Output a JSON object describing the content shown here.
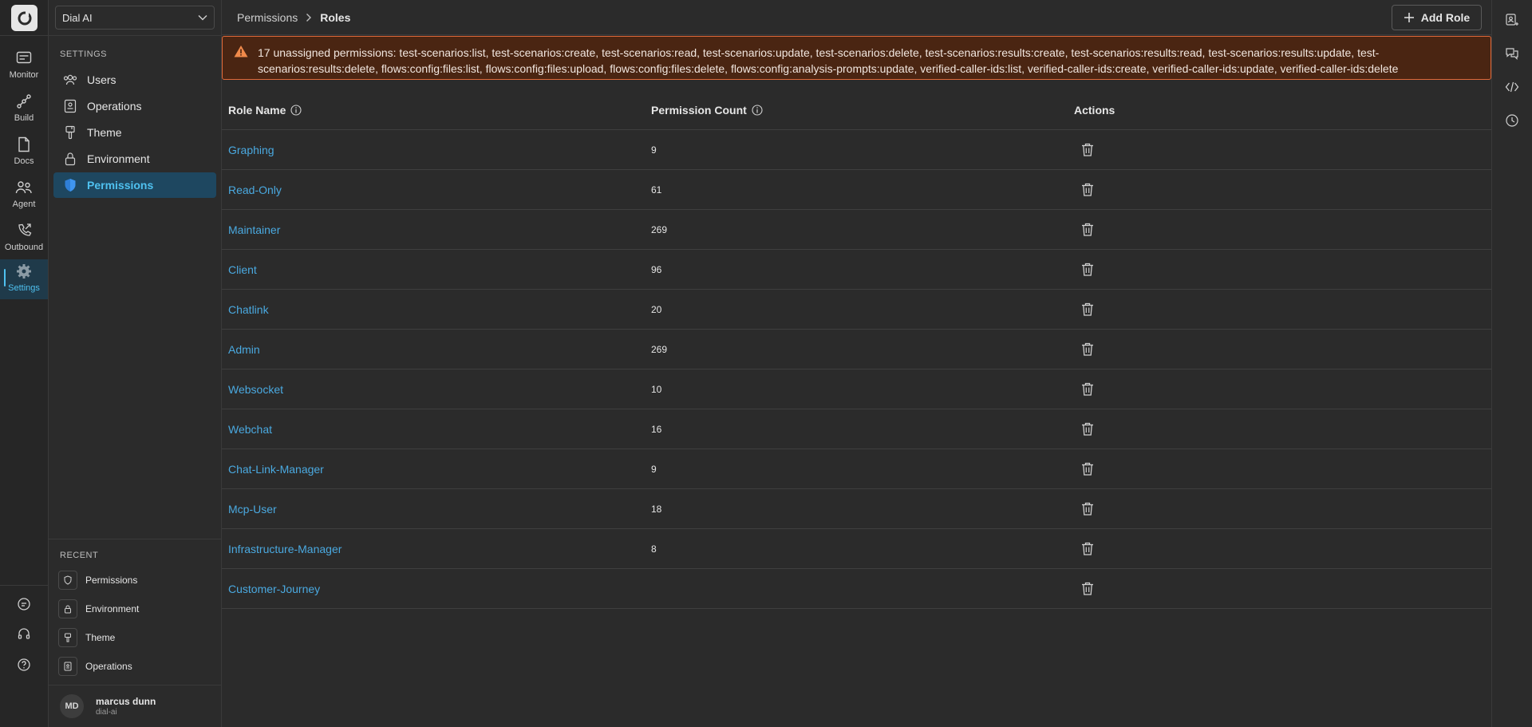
{
  "rail": {
    "items": [
      {
        "label": "Monitor",
        "icon": "monitor-icon"
      },
      {
        "label": "Build",
        "icon": "build-icon"
      },
      {
        "label": "Docs",
        "icon": "docs-icon"
      },
      {
        "label": "Agent",
        "icon": "agent-icon"
      },
      {
        "label": "Outbound",
        "icon": "outbound-icon"
      },
      {
        "label": "Settings",
        "icon": "gear-icon",
        "active": true
      }
    ],
    "bottom_icons": [
      "chat-icon",
      "headset-icon",
      "help-icon"
    ]
  },
  "sidebar": {
    "workspace": "Dial AI",
    "settings_title": "SETTINGS",
    "items": [
      {
        "label": "Users",
        "icon": "users-icon"
      },
      {
        "label": "Operations",
        "icon": "operations-icon"
      },
      {
        "label": "Theme",
        "icon": "paint-brush-icon"
      },
      {
        "label": "Environment",
        "icon": "lock-icon"
      },
      {
        "label": "Permissions",
        "icon": "shield-icon",
        "active": true
      }
    ],
    "recent_title": "RECENT",
    "recent": [
      {
        "label": "Permissions",
        "icon": "shield-icon"
      },
      {
        "label": "Environment",
        "icon": "lock-icon"
      },
      {
        "label": "Theme",
        "icon": "paint-brush-icon"
      },
      {
        "label": "Operations",
        "icon": "operations-icon"
      }
    ],
    "user": {
      "initials": "MD",
      "name": "marcus dunn",
      "org": "dial-ai"
    }
  },
  "header": {
    "breadcrumb_parent": "Permissions",
    "breadcrumb_current": "Roles",
    "add_role_label": "Add Role"
  },
  "alert": {
    "text": "17 unassigned permissions: test-scenarios:list, test-scenarios:create, test-scenarios:read, test-scenarios:update, test-scenarios:delete, test-scenarios:results:create, test-scenarios:results:read, test-scenarios:results:update, test-scenarios:results:delete, flows:config:files:list, flows:config:files:upload, flows:config:files:delete, flows:config:analysis-prompts:update, verified-caller-ids:list, verified-caller-ids:create, verified-caller-ids:update, verified-caller-ids:delete"
  },
  "table": {
    "columns": [
      "Role Name",
      "Permission Count",
      "Actions"
    ],
    "rows": [
      {
        "name": "Graphing",
        "count": "9"
      },
      {
        "name": "Read-Only",
        "count": "61"
      },
      {
        "name": "Maintainer",
        "count": "269"
      },
      {
        "name": "Client",
        "count": "96"
      },
      {
        "name": "Chatlink",
        "count": "20"
      },
      {
        "name": "Admin",
        "count": "269"
      },
      {
        "name": "Websocket",
        "count": "10"
      },
      {
        "name": "Webchat",
        "count": "16"
      },
      {
        "name": "Chat-Link-Manager",
        "count": "9"
      },
      {
        "name": "Mcp-User",
        "count": "18"
      },
      {
        "name": "Infrastructure-Manager",
        "count": "8"
      },
      {
        "name": "Customer-Journey",
        "count": ""
      }
    ]
  },
  "right_rail": {
    "icons": [
      "contact-card-icon",
      "chat-bubbles-icon",
      "code-icon",
      "history-icon"
    ]
  },
  "colors": {
    "accent": "#4fc1f0",
    "link": "#4aa9e0",
    "alert_bg": "#4a2512",
    "alert_border": "#e0693a",
    "background": "#2b2b2b"
  }
}
